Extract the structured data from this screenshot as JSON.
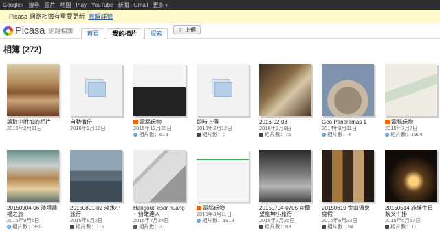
{
  "gbar": [
    "Google+",
    "搜尋",
    "圖片",
    "地圖",
    "Play",
    "YouTube",
    "新聞",
    "Gmail",
    "更多"
  ],
  "notice": {
    "text": "Picasa 網路相簿有重要更新",
    "link": "瞭解詳情"
  },
  "header": {
    "logo": "Picasa",
    "logo_sub": "網路相簿",
    "tabs": [
      "首頁",
      "我的相片",
      "探索"
    ],
    "active_tab": "我的相片",
    "upload": "上傳"
  },
  "page_title": "相簿 (272)",
  "albums": [
    {
      "title": "讀取中附加的相片",
      "date": "2016年2月11日",
      "count": "",
      "icon": "none",
      "rss": false,
      "thumb": "lobby"
    },
    {
      "title": "自動備份",
      "date": "2016年2月12日",
      "count": "",
      "icon": "none",
      "rss": false,
      "thumb": "placeholder"
    },
    {
      "title": "電腦玩物",
      "date": "2015年12月20日",
      "count": "相片數：618",
      "icon": "globe",
      "rss": true,
      "thumb": "screenshot"
    },
    {
      "title": "即時上傳",
      "date": "2016年2月12日",
      "count": "相片數：0",
      "icon": "lock",
      "rss": false,
      "thumb": "placeholder"
    },
    {
      "title": "2016-02-08",
      "date": "2016年2月8日",
      "count": "相片數：75",
      "icon": "lock",
      "rss": false,
      "thumb": "restaurant"
    },
    {
      "title": "Geo Panoramas 1",
      "date": "2014年9月11日",
      "count": "相片數：4",
      "icon": "globe",
      "rss": false,
      "thumb": "panorama"
    },
    {
      "title": "電腦玩物",
      "date": "2015年7月7日",
      "count": "相片數：1904",
      "icon": "globe",
      "rss": true,
      "thumb": "map"
    },
    {
      "title": "20150904-06 清境農場之旅",
      "date": "2015年9月6日",
      "count": "相片數：390",
      "icon": "globe",
      "rss": false,
      "thumb": "food"
    },
    {
      "title": "20150801-02 淡水小旅行",
      "date": "2015年8月2日",
      "count": "相片數：119",
      "icon": "lock",
      "rss": false,
      "thumb": "harbor"
    },
    {
      "title": "Hangout: esor huang + 俯瞰達人",
      "date": "2015年7月24日",
      "count": "相片數：3",
      "icon": "people",
      "rss": false,
      "thumb": "magazine"
    },
    {
      "title": "電腦玩物",
      "date": "2015年3月11日",
      "count": "相片數：1918",
      "icon": "globe",
      "rss": true,
      "thumb": "doc"
    },
    {
      "title": "20150704-0705 宜蘭望龍埤小旅行",
      "date": "2015年7月25日",
      "count": "相片數：83",
      "icon": "lock",
      "rss": false,
      "thumb": "stairs"
    },
    {
      "title": "20150619 金山溫泉度假",
      "date": "2015年6月23日",
      "count": "相片數：54",
      "icon": "lock",
      "rss": false,
      "thumb": "shelves"
    },
    {
      "title": "20150514 施維生日飲叉牛排",
      "date": "2015年5月17日",
      "count": "相片數：11",
      "icon": "lock",
      "rss": false,
      "thumb": "dark"
    }
  ]
}
